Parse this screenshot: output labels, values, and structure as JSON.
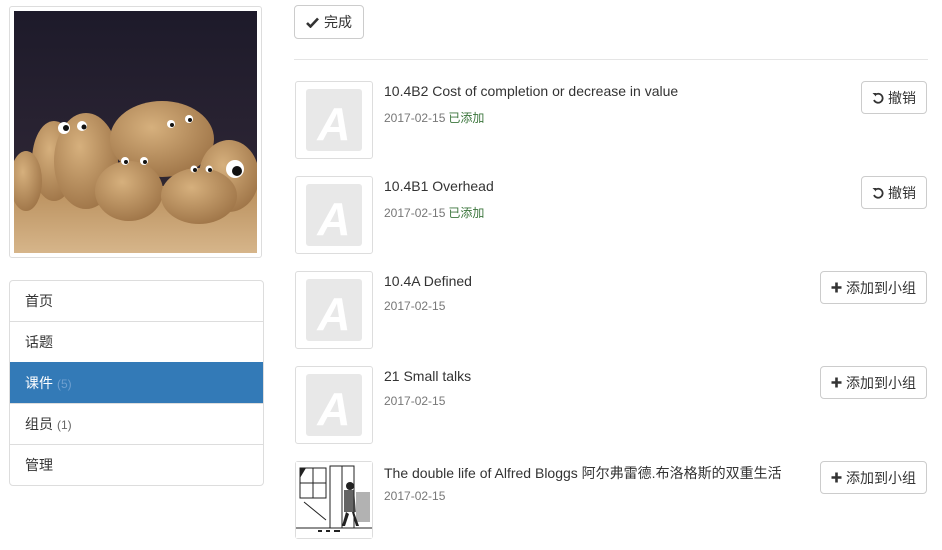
{
  "toolbar": {
    "done_label": "完成"
  },
  "nav": {
    "items": [
      {
        "label": "首页",
        "count": ""
      },
      {
        "label": "话题",
        "count": ""
      },
      {
        "label": "课件",
        "count": "(5)"
      },
      {
        "label": "组员",
        "count": "(1)"
      },
      {
        "label": "管理",
        "count": ""
      }
    ],
    "active_index": 2
  },
  "courseware": [
    {
      "title": "10.4B2 Cost of completion or decrease in value",
      "date": "2017-02-15",
      "status": "已添加",
      "action": "撤销",
      "thumb": "letter-a-icon"
    },
    {
      "title": "10.4B1 Overhead",
      "date": "2017-02-15",
      "status": "已添加",
      "action": "撤销",
      "thumb": "letter-a-icon"
    },
    {
      "title": "10.4A Defined",
      "date": "2017-02-15",
      "status": "",
      "action": "添加到小组",
      "thumb": "letter-a-icon"
    },
    {
      "title": "21 Small talks",
      "date": "2017-02-15",
      "status": "",
      "action": "添加到小组",
      "thumb": "letter-a-icon"
    },
    {
      "title": "The double life of Alfred Bloggs 阿尔弗雷德.布洛格斯的双重生活",
      "date": "2017-02-15",
      "status": "",
      "action": "添加到小组",
      "thumb": "comic-illustration"
    }
  ],
  "colors": {
    "active_nav": "#337ab7",
    "status_added": "#3c763d",
    "border": "#dddddd"
  }
}
